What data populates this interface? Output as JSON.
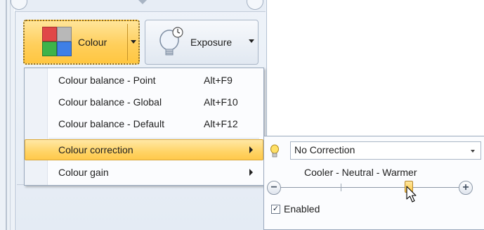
{
  "ribbon": {
    "colour_button": {
      "label": "Colour"
    },
    "exposure_button": {
      "label": "Exposure"
    }
  },
  "menu": {
    "items": [
      {
        "label": "Colour balance - Point",
        "shortcut": "Alt+F9"
      },
      {
        "label": "Colour balance - Global",
        "shortcut": "Alt+F10"
      },
      {
        "label": "Colour balance - Default",
        "shortcut": "Alt+F12"
      },
      {
        "label": "Colour correction",
        "shortcut": ""
      },
      {
        "label": "Colour gain",
        "shortcut": ""
      }
    ]
  },
  "submenu": {
    "correction_select": {
      "value": "No Correction"
    },
    "slider": {
      "caption": "Cooler - Neutral - Warmer",
      "minus_symbol": "−",
      "plus_symbol": "+",
      "position_fraction": 0.72
    },
    "enabled": {
      "label": "Enabled",
      "checked": true,
      "check_glyph": "✓"
    }
  },
  "colors": {
    "highlight": "#ffd466",
    "palette_red": "#e04848",
    "palette_grey": "#b8b8b8",
    "palette_green": "#3db34a",
    "palette_blue": "#3f7fe6"
  },
  "icons": {
    "colour_palette": "colour-palette-icon",
    "exposure_bulb": "light-bulb-icon",
    "correction_bulb": "light-bulb-small-icon",
    "submenu_arrow": "chevron-right-icon",
    "dropdown_arrow": "chevron-down-icon"
  }
}
